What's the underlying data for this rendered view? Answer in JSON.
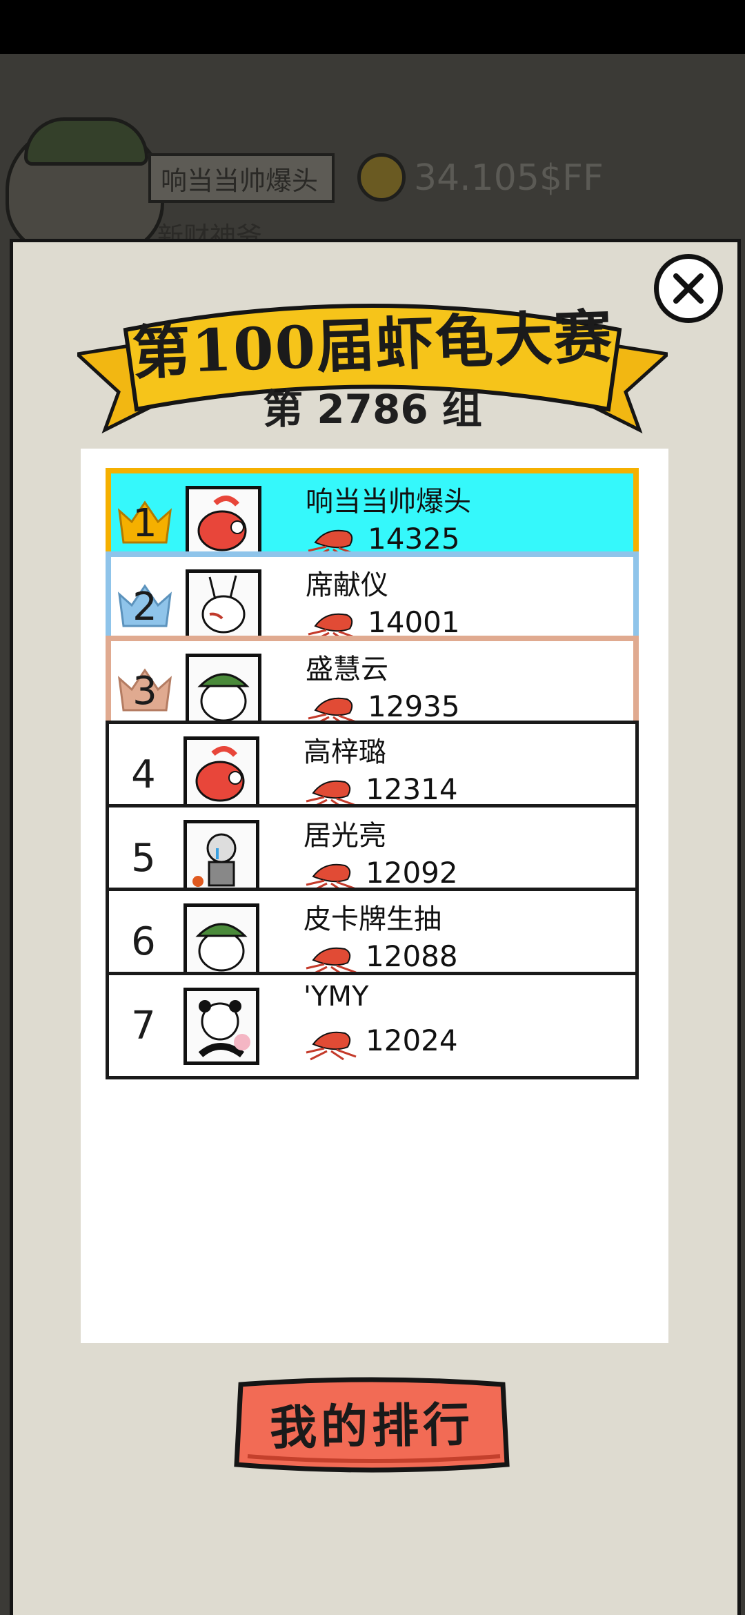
{
  "background": {
    "player_name": "响当当帅爆头",
    "money": "34.105$FF",
    "subtitle": "新财神爷"
  },
  "banner": {
    "title": "第100届虾龟大赛",
    "group": "第 2786 组"
  },
  "ranking": [
    {
      "rank": "1",
      "name": "响当当帅爆头",
      "score": "14325",
      "avatar": "shrimp-avatar"
    },
    {
      "rank": "2",
      "name": "席献仪",
      "score": "14001",
      "avatar": "rabbit-avatar"
    },
    {
      "rank": "3",
      "name": "盛慧云",
      "score": "12935",
      "avatar": "beanie-avatar"
    },
    {
      "rank": "4",
      "name": "高梓璐",
      "score": "12314",
      "avatar": "shrimp-avatar"
    },
    {
      "rank": "5",
      "name": "居光亮",
      "score": "12092",
      "avatar": "crying-man-avatar"
    },
    {
      "rank": "6",
      "name": "皮卡牌生抽",
      "score": "12088",
      "avatar": "beanie-avatar"
    },
    {
      "rank": "7",
      "name": "'YMY",
      "score": "12024",
      "avatar": "panda-avatar"
    }
  ],
  "buttons": {
    "my_rank": "我的排行"
  },
  "colors": {
    "gold_frame": "#f5b000",
    "gold_fill": "#35f8fb",
    "silver_frame": "#8fc4ea",
    "bronze_frame": "#e0aa90",
    "button_red": "#f26b55",
    "ribbon_yellow": "#f6c41a"
  },
  "icons": {
    "close": "close-icon",
    "score": "shrimp-icon"
  }
}
